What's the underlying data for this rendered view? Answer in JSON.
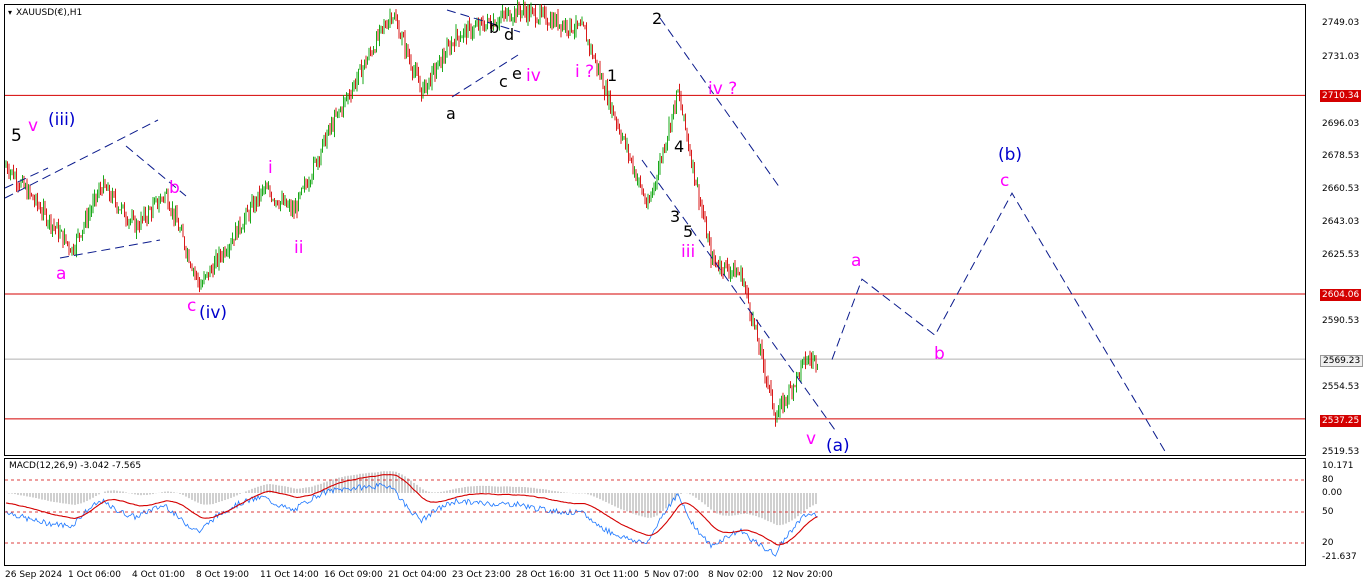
{
  "header": {
    "symbol": "XAUUSD(€),H1"
  },
  "chart_data": {
    "type": "candlestick",
    "symbol": "XAUUSD(€)",
    "timeframe": "H1",
    "price_axis_ticks": [
      "2749.03",
      "2731.03",
      "2696.03",
      "2678.53",
      "2660.53",
      "2643.03",
      "2625.53",
      "2590.53",
      "2554.53",
      "2519.53"
    ],
    "horizontal_levels": [
      {
        "value": "2710.34",
        "color": "#d40000"
      },
      {
        "value": "2604.06",
        "color": "#d40000"
      },
      {
        "value": "2537.25",
        "color": "#d40000"
      }
    ],
    "current_price": "2569.23",
    "time_axis_ticks": [
      "26 Sep 2024",
      "1 Oct 06:00",
      "4 Oct 01:00",
      "8 Oct 19:00",
      "11 Oct 14:00",
      "16 Oct 09:00",
      "21 Oct 04:00",
      "23 Oct 23:00",
      "28 Oct 16:00",
      "31 Oct 11:00",
      "5 Nov 07:00",
      "8 Nov 02:00",
      "12 Nov 20:00"
    ],
    "price_path": [
      {
        "t": "26 Sep 2024",
        "p": 2672
      },
      {
        "t": "1 Oct 06:00",
        "p": 2628
      },
      {
        "t": "1 Oct 06:00",
        "p": 2662
      },
      {
        "t": "4 Oct 01:00",
        "p": 2640
      },
      {
        "t": "4 Oct 01:00",
        "p": 2658
      },
      {
        "t": "8 Oct 19:00",
        "p": 2608
      },
      {
        "t": "11 Oct 14:00",
        "p": 2660
      },
      {
        "t": "11 Oct 14:00",
        "p": 2648
      },
      {
        "t": "16 Oct 09:00",
        "p": 2690
      },
      {
        "t": "21 Oct 04:00",
        "p": 2755
      },
      {
        "t": "21 Oct 04:00",
        "p": 2712
      },
      {
        "t": "23 Oct 23:00",
        "p": 2742
      },
      {
        "t": "28 Oct 16:00",
        "p": 2756
      },
      {
        "t": "31 Oct 11:00",
        "p": 2745
      },
      {
        "t": "5 Nov 07:00",
        "p": 2650
      },
      {
        "t": "5 Nov 07:00",
        "p": 2712
      },
      {
        "t": "8 Nov 02:00",
        "p": 2622
      },
      {
        "t": "8 Nov 02:00",
        "p": 2614
      },
      {
        "t": "12 Nov 20:00",
        "p": 2538
      },
      {
        "t": "12 Nov 20:00",
        "p": 2569
      }
    ],
    "wave_labels": [
      {
        "text": "5",
        "color": "#000000"
      },
      {
        "text": "v",
        "color": "#ff00ff"
      },
      {
        "text": "(iii)",
        "color": "#0000cc"
      },
      {
        "text": "a",
        "color": "#ff00ff"
      },
      {
        "text": "b",
        "color": "#ff00ff"
      },
      {
        "text": "c",
        "color": "#ff00ff"
      },
      {
        "text": "(iv)",
        "color": "#0000cc"
      },
      {
        "text": "i",
        "color": "#ff00ff"
      },
      {
        "text": "ii",
        "color": "#ff00ff"
      },
      {
        "text": "a",
        "color": "#000000"
      },
      {
        "text": "b",
        "color": "#000000"
      },
      {
        "text": "d",
        "color": "#000000"
      },
      {
        "text": "c",
        "color": "#000000"
      },
      {
        "text": "e",
        "color": "#000000"
      },
      {
        "text": "iv",
        "color": "#ff00ff"
      },
      {
        "text": "i ?",
        "color": "#ff00ff"
      },
      {
        "text": "1",
        "color": "#000000"
      },
      {
        "text": "2",
        "color": "#000000"
      },
      {
        "text": "iv ?",
        "color": "#ff00ff"
      },
      {
        "text": "4",
        "color": "#000000"
      },
      {
        "text": "3",
        "color": "#000000"
      },
      {
        "text": "5",
        "color": "#000000"
      },
      {
        "text": "iii",
        "color": "#ff00ff"
      },
      {
        "text": "v",
        "color": "#ff00ff"
      },
      {
        "text": "(a)",
        "color": "#0000cc"
      },
      {
        "text": "a",
        "color": "#ff00ff"
      },
      {
        "text": "b",
        "color": "#ff00ff"
      },
      {
        "text": "(b)",
        "color": "#0000cc"
      },
      {
        "text": "c",
        "color": "#ff00ff"
      }
    ],
    "projection_path": [
      {
        "t": "12 Nov 20:00",
        "p": 2569
      },
      {
        "p": 2612
      },
      {
        "p": 2582
      },
      {
        "p": 2658
      },
      {
        "p": 2519
      }
    ],
    "up_color": "#00a000",
    "down_color": "#d40000",
    "macd": {
      "label": "MACD(12,26,9) -3.042 -7.565",
      "axis_ticks": [
        "10.171",
        "80",
        "0.00",
        "50",
        "20",
        "-21.637"
      ],
      "current_main": -3.042,
      "current_signal": -7.565,
      "histogram_color": "#c0c0c0",
      "signal_color": "#d40000",
      "main_line_color": "#1e78ff"
    }
  }
}
